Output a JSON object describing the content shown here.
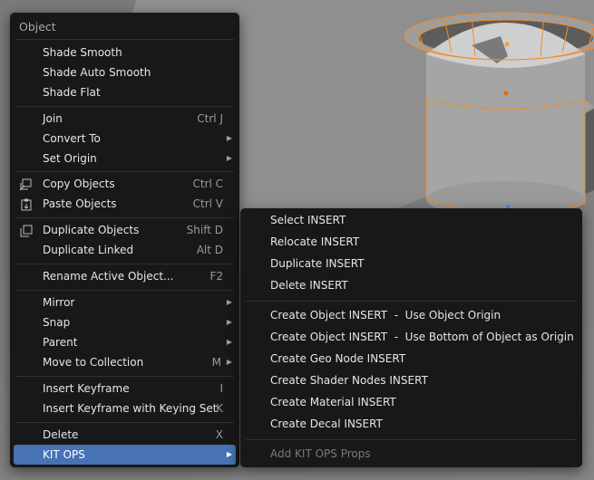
{
  "main_menu": {
    "title": "Object",
    "items": [
      {
        "label": "Shade Smooth"
      },
      {
        "label": "Shade Auto Smooth"
      },
      {
        "label": "Shade Flat"
      },
      {
        "label": "Join",
        "shortcut": "Ctrl J"
      },
      {
        "label": "Convert To",
        "arrow": "▶"
      },
      {
        "label": "Set Origin",
        "arrow": "▶"
      },
      {
        "label": "Copy Objects",
        "shortcut": "Ctrl C",
        "icon": "copy-icon"
      },
      {
        "label": "Paste Objects",
        "shortcut": "Ctrl V",
        "icon": "paste-icon"
      },
      {
        "label": "Duplicate Objects",
        "shortcut": "Shift D",
        "icon": "duplicate-icon"
      },
      {
        "label": "Duplicate Linked",
        "shortcut": "Alt D"
      },
      {
        "label": "Rename Active Object...",
        "shortcut": "F2"
      },
      {
        "label": "Mirror",
        "arrow": "▶"
      },
      {
        "label": "Snap",
        "arrow": "▶"
      },
      {
        "label": "Parent",
        "arrow": "▶"
      },
      {
        "label": "Move to Collection",
        "shortcut": "M",
        "arrow": "▶"
      },
      {
        "label": "Insert Keyframe",
        "shortcut": "I"
      },
      {
        "label": "Insert Keyframe with Keying Set",
        "shortcut": "K"
      },
      {
        "label": "Delete",
        "shortcut": "X"
      },
      {
        "label": "KIT OPS",
        "arrow": "▶"
      }
    ]
  },
  "sub_menu": {
    "items": [
      {
        "label": "Select INSERT"
      },
      {
        "label": "Relocate INSERT"
      },
      {
        "label": "Duplicate INSERT"
      },
      {
        "label": "Delete INSERT"
      },
      {
        "label": "Create Object INSERT  -  Use Object Origin"
      },
      {
        "label": "Create Object INSERT  -  Use Bottom of Object as Origin"
      },
      {
        "label": "Create Geo Node INSERT"
      },
      {
        "label": "Create Shader Nodes INSERT"
      },
      {
        "label": "Create Material INSERT"
      },
      {
        "label": "Create Decal INSERT"
      },
      {
        "label": "Add KIT OPS Props"
      }
    ]
  },
  "colors": {
    "menu_bg": "#181818",
    "highlight": "#4772b3",
    "selection_outline": "#f08c2a"
  }
}
